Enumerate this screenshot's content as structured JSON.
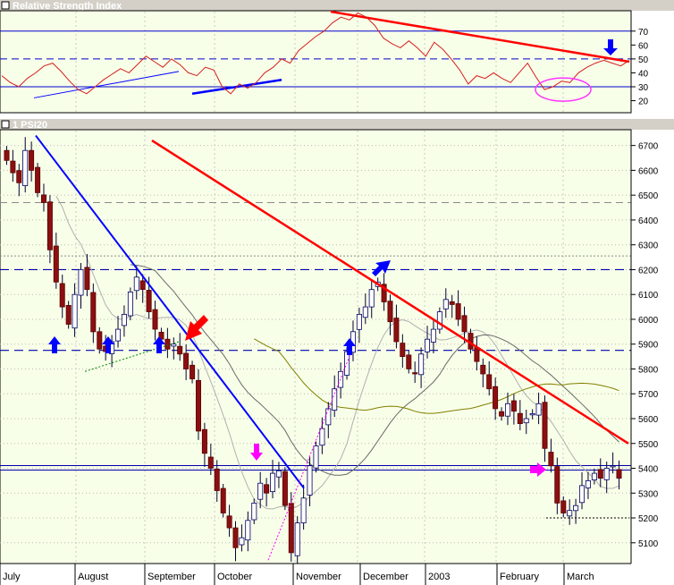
{
  "panels": {
    "rsi_title": "Relative Strength Index",
    "price_title": "1 PSI20"
  },
  "colors": {
    "background": "#f8ffe8",
    "titlebar": "#d4d0c8",
    "up_candle": "#ffffff",
    "down_candle": "#8b0f12",
    "trend_red": "#ff0000",
    "trend_blue": "#0000ff",
    "support_dashed": "#0000aa",
    "ma_olive": "#808000",
    "ma_gray": "#555555",
    "arrow_blue": "#0000ff",
    "arrow_magenta": "#ff00ff"
  },
  "chart_data": [
    {
      "type": "line",
      "panel": "rsi",
      "title": "Relative Strength Index",
      "ylim": [
        12,
        84
      ],
      "yticks": [
        "20",
        "30",
        "40",
        "50",
        "60",
        "70"
      ],
      "horizontal_lines": [
        {
          "y": 70,
          "style": "solid"
        },
        {
          "y": 50,
          "style": "dashed"
        },
        {
          "y": 30,
          "style": "solid"
        }
      ],
      "series": [
        {
          "values": [
            38,
            33,
            30,
            36,
            40,
            45,
            47,
            41,
            34,
            28,
            25,
            30,
            35,
            39,
            43,
            40,
            46,
            52,
            48,
            44,
            50,
            46,
            40,
            38,
            44,
            42,
            30,
            25,
            32,
            29,
            33,
            40,
            44,
            50,
            47,
            56,
            61,
            66,
            70,
            76,
            80,
            78,
            83,
            80,
            74,
            65,
            61,
            58,
            63,
            58,
            52,
            62,
            57,
            50,
            42,
            32,
            38,
            36,
            40,
            36,
            33,
            40,
            47,
            37,
            28,
            30,
            34,
            33,
            40,
            44,
            47,
            49,
            47,
            45,
            49
          ]
        }
      ]
    },
    {
      "type": "candlestick",
      "panel": "price",
      "title": "1 PSI20",
      "ylim": [
        5020,
        6760
      ],
      "yticks": [
        "5100",
        "5200",
        "5300",
        "5400",
        "5500",
        "5600",
        "5700",
        "5800",
        "5900",
        "6000",
        "6100",
        "6200",
        "6300",
        "6400",
        "6500",
        "6600",
        "6700"
      ],
      "xticks": [
        "July",
        "August",
        "September",
        "October",
        "November",
        "December",
        "2003",
        "February",
        "March"
      ],
      "horizontal_lines": [
        {
          "y": 6200,
          "style": "dashed"
        },
        {
          "y": 5875,
          "style": "dashed"
        },
        {
          "y": 5400,
          "style": "solid"
        }
      ],
      "closes": [
        6640,
        6590,
        6550,
        6680,
        6600,
        6510,
        6470,
        6280,
        6150,
        6050,
        5980,
        6100,
        6200,
        6120,
        5950,
        5880,
        5870,
        5910,
        5960,
        6020,
        6110,
        6170,
        6120,
        6030,
        5960,
        5920,
        5880,
        5900,
        5860,
        5800,
        5760,
        5550,
        5460,
        5400,
        5310,
        5220,
        5160,
        5080,
        5120,
        5190,
        5260,
        5340,
        5300,
        5380,
        5390,
        5250,
        5060,
        5180,
        5280,
        5410,
        5490,
        5560,
        5640,
        5720,
        5790,
        5870,
        5950,
        6020,
        6050,
        6120,
        6150,
        6070,
        5990,
        5910,
        5850,
        5800,
        5780,
        5860,
        5920,
        5960,
        6030,
        6080,
        6060,
        6000,
        5950,
        5880,
        5830,
        5780,
        5720,
        5640,
        5610,
        5660,
        5630,
        5580,
        5600,
        5620,
        5660,
        5480,
        5410,
        5260,
        5220,
        5230,
        5250,
        5330,
        5350,
        5380,
        5360,
        5400,
        5410,
        5360
      ]
    }
  ]
}
